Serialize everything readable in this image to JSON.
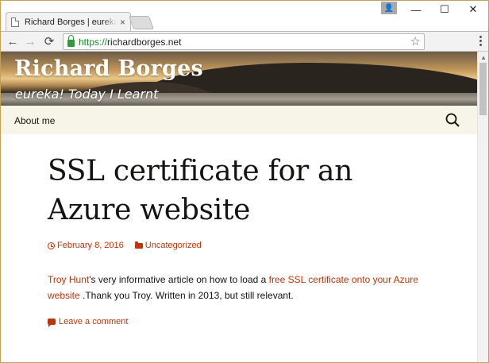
{
  "browser": {
    "tab_title": "Richard Borges | eureka! Today I Learnt",
    "tab_close": "×",
    "url_scheme": "https://",
    "url_host": "richardborges.net",
    "window_controls": {
      "minimize": "—",
      "maximize": "☐",
      "close": "✕"
    },
    "nav": {
      "back": "←",
      "forward": "→",
      "reload": "⟳",
      "bookmark": "☆"
    },
    "profile_glyph": "👤"
  },
  "site": {
    "title": "Richard Borges",
    "description": "eureka! Today I Learnt",
    "nav_items": [
      {
        "label": "About me"
      }
    ]
  },
  "post": {
    "title": "SSL certificate for an Azure website",
    "date": "February 8, 2016",
    "category": "Uncategorized",
    "content": {
      "author_link": "Troy Hunt",
      "after_author": "'s very informative article on how to load a ",
      "article_link": "free SSL certificate onto your Azure website",
      "tail": " .Thank you Troy. Written in 2013, but still relevant."
    },
    "comment_link": "Leave a comment"
  },
  "colors": {
    "accent": "#bc360a",
    "nav_background": "#f7f5e7",
    "text": "#141412",
    "secure_green": "#1a8a2f"
  },
  "icons": {
    "tab": "document-icon",
    "lock": "lock-icon",
    "search": "search-icon",
    "date": "clock-icon",
    "category": "folder-icon",
    "comment": "comment-icon"
  }
}
